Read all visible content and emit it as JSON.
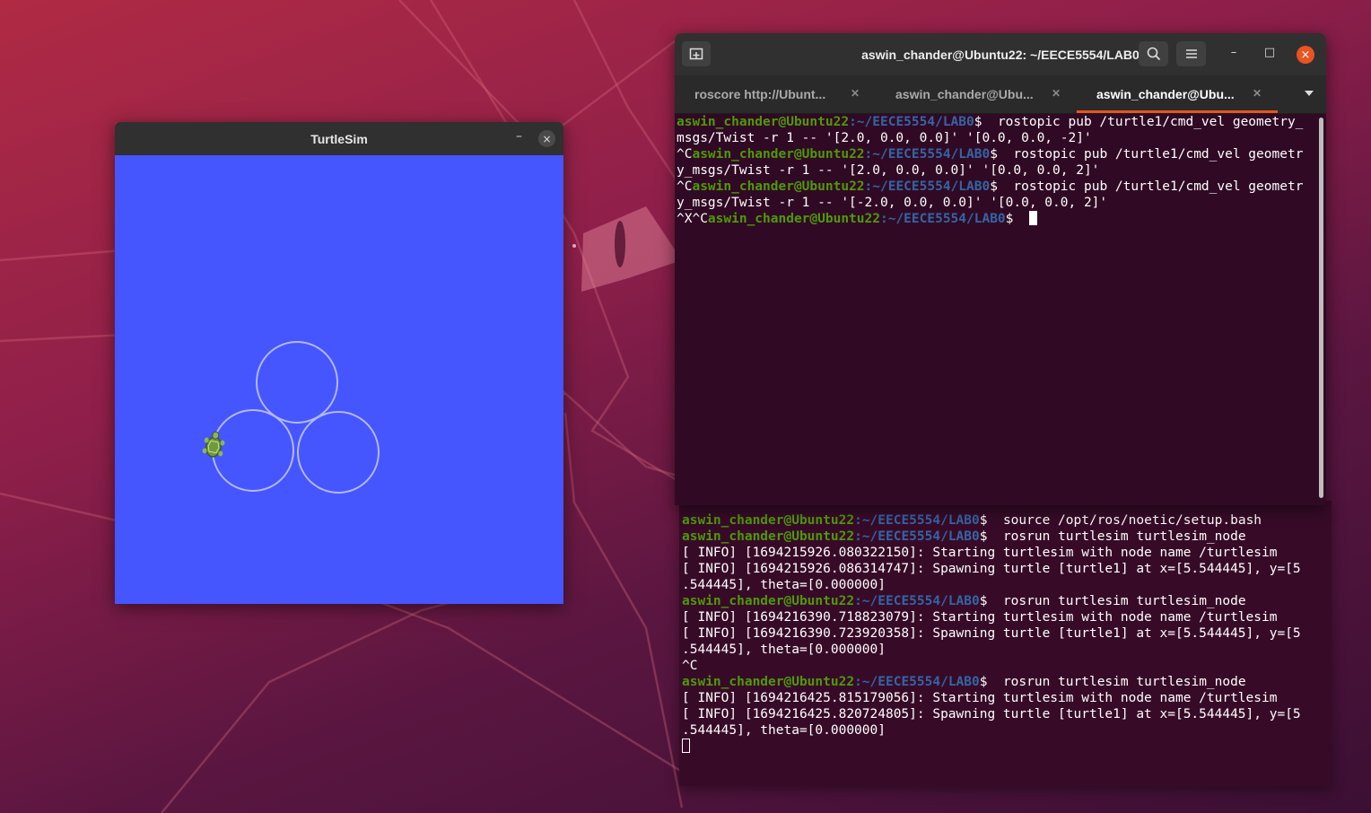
{
  "turtlesim": {
    "title": "TurtleSim",
    "minimize_symbol": "–",
    "close_symbol": "×",
    "background_color": "#4556ff",
    "path_color": "#b3b8ff"
  },
  "terminal": {
    "title": "aswin_chander@Ubuntu22: ~/EECE5554/LAB0",
    "window_controls": [
      "–",
      "□",
      "×"
    ],
    "tabs": [
      {
        "label": "roscore http://Ubunt...",
        "active": false
      },
      {
        "label": "aswin_chander@Ubu...",
        "active": false
      },
      {
        "label": "aswin_chander@Ubu...",
        "active": true
      }
    ],
    "prompt_user": "aswin_chander@Ubuntu22",
    "prompt_path": ":~/EECE5554/LAB0",
    "prompt_dollar": "$ ",
    "lines": [
      {
        "prefix": "",
        "prompt": true,
        "text": " rostopic pub /turtle1/cmd_vel geometry_"
      },
      {
        "prefix": "",
        "prompt": false,
        "text": "msgs/Twist -r 1 -- '[2.0, 0.0, 0.0]' '[0.0, 0.0, -2]'"
      },
      {
        "prefix": "^C",
        "prompt": true,
        "text": " rostopic pub /turtle1/cmd_vel geometr"
      },
      {
        "prefix": "",
        "prompt": false,
        "text": "y_msgs/Twist -r 1 -- '[2.0, 0.0, 0.0]' '[0.0, 0.0, 2]'"
      },
      {
        "prefix": "^C",
        "prompt": true,
        "text": " rostopic pub /turtle1/cmd_vel geometr"
      },
      {
        "prefix": "",
        "prompt": false,
        "text": "y_msgs/Twist -r 1 -- '[-2.0, 0.0, 0.0]' '[0.0, 0.0, 2]'"
      },
      {
        "prefix": "^X^C",
        "prompt": true,
        "text": " ",
        "cursor": true
      }
    ]
  },
  "terminal2": {
    "lines": [
      {
        "prompt": true,
        "text": " source /opt/ros/noetic/setup.bash"
      },
      {
        "prompt": true,
        "text": " rosrun turtlesim turtlesim_node"
      },
      {
        "prompt": false,
        "text": "[ INFO] [1694215926.080322150]: Starting turtlesim with node name /turtlesim"
      },
      {
        "prompt": false,
        "text": "[ INFO] [1694215926.086314747]: Spawning turtle [turtle1] at x=[5.544445], y=[5"
      },
      {
        "prompt": false,
        "text": ".544445], theta=[0.000000]"
      },
      {
        "prompt": true,
        "text": " rosrun turtlesim turtlesim_node"
      },
      {
        "prompt": false,
        "text": "[ INFO] [1694216390.718823079]: Starting turtlesim with node name /turtlesim"
      },
      {
        "prompt": false,
        "text": "[ INFO] [1694216390.723920358]: Spawning turtle [turtle1] at x=[5.544445], y=[5"
      },
      {
        "prompt": false,
        "text": ".544445], theta=[0.000000]"
      },
      {
        "prompt": false,
        "text": "^C"
      },
      {
        "prompt": true,
        "text": " rosrun turtlesim turtlesim_node"
      },
      {
        "prompt": false,
        "text": "[ INFO] [1694216425.815179056]: Starting turtlesim with node name /turtlesim"
      },
      {
        "prompt": false,
        "text": "[ INFO] [1694216425.820724805]: Spawning turtle [turtle1] at x=[5.544445], y=[5"
      },
      {
        "prompt": false,
        "text": ".544445], theta=[0.000000]"
      },
      {
        "prompt": false,
        "text": "",
        "cursor": true
      }
    ]
  },
  "colors": {
    "prompt_user": "#4e9a06",
    "prompt_path": "#3465a4",
    "accent": "#e95420"
  }
}
